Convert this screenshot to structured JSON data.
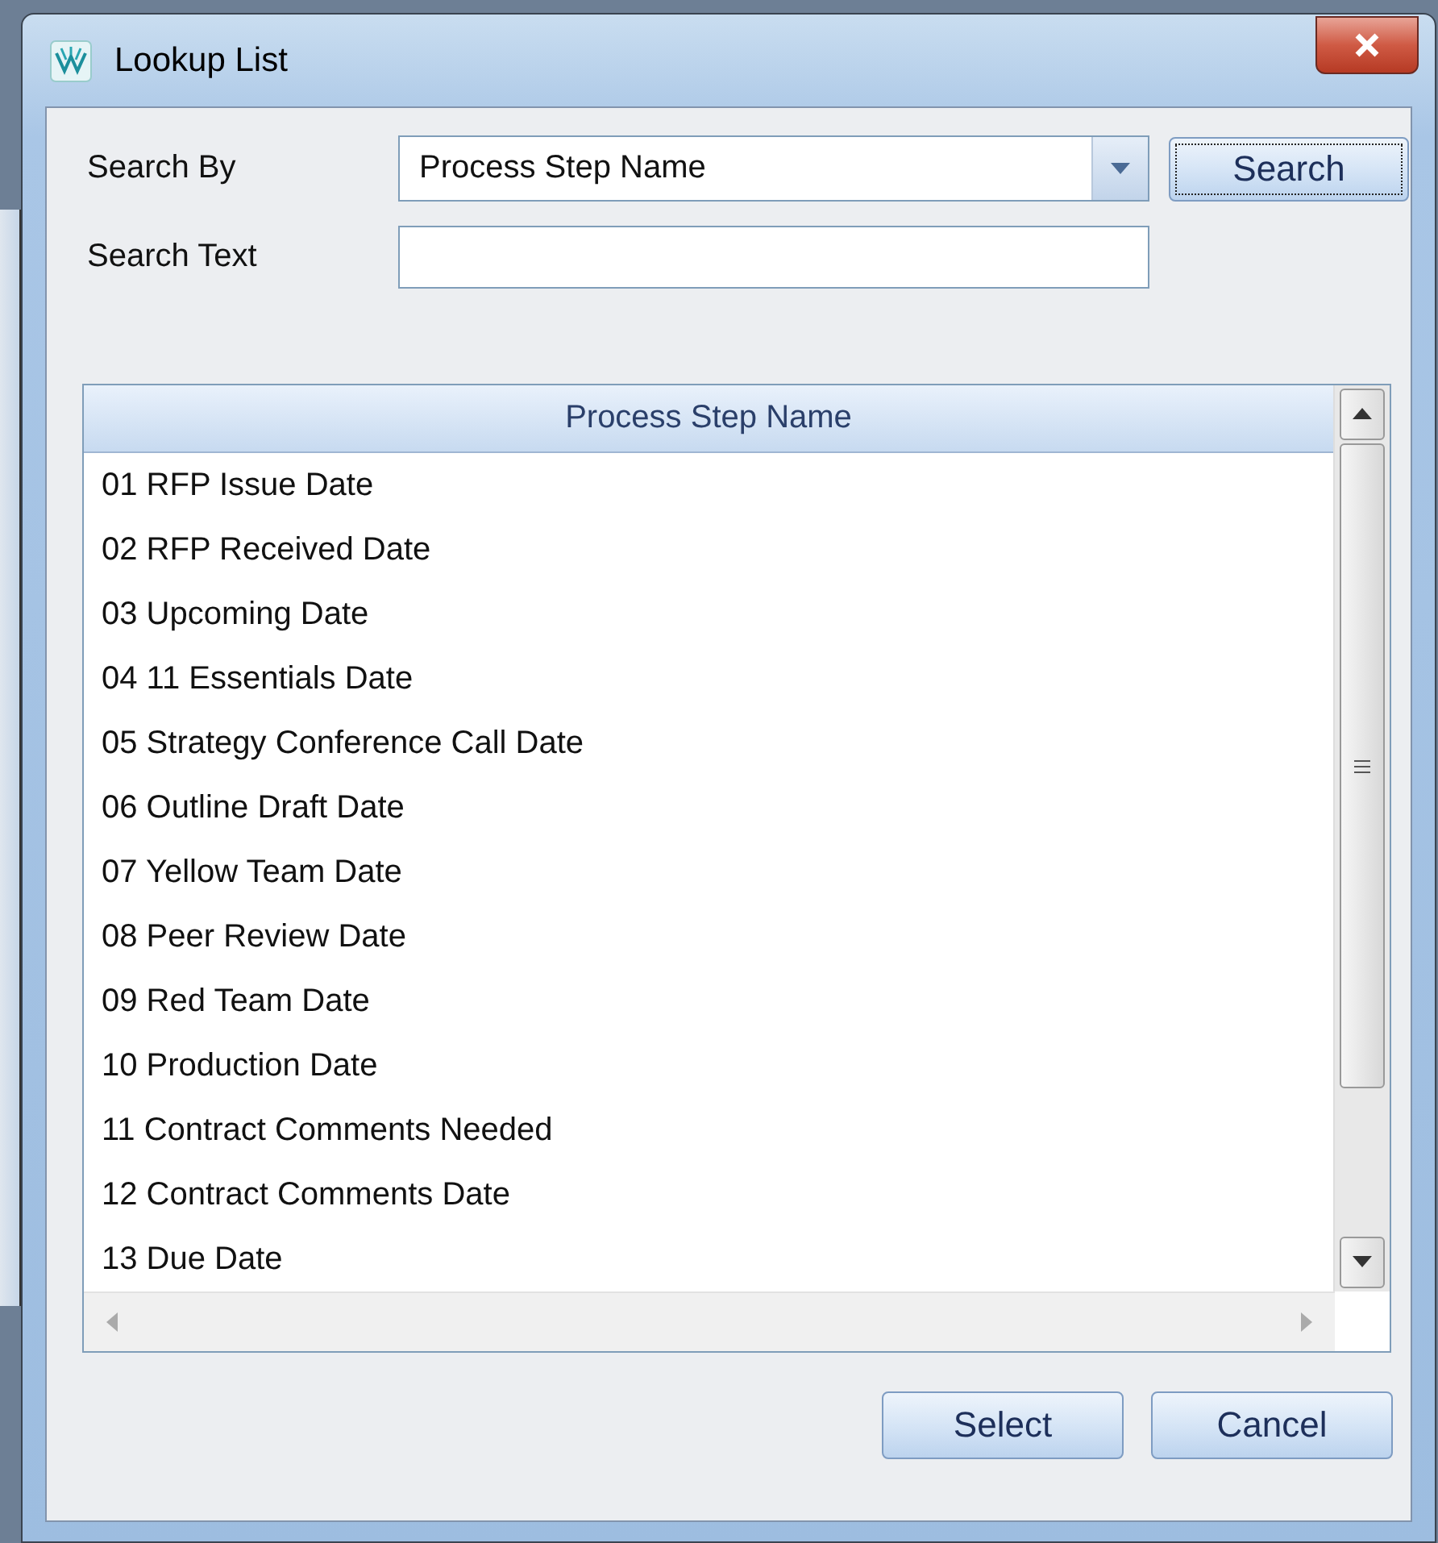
{
  "window": {
    "title": "Lookup List"
  },
  "form": {
    "search_by": {
      "label": "Search By",
      "value": "Process Step Name"
    },
    "search_text": {
      "label": "Search Text"
    },
    "search_button": {
      "label": "Search",
      "focused": true
    }
  },
  "table": {
    "columns": [
      "Process Step Name"
    ],
    "rows": [
      {
        "name": "01 RFP Issue Date"
      },
      {
        "name": "02 RFP Received Date"
      },
      {
        "name": "03 Upcoming Date"
      },
      {
        "name": "04 11 Essentials Date"
      },
      {
        "name": "05 Strategy Conference Call Date"
      },
      {
        "name": "06 Outline Draft Date"
      },
      {
        "name": "07 Yellow Team Date"
      },
      {
        "name": "08 Peer Review Date"
      },
      {
        "name": "09 Red Team Date"
      },
      {
        "name": "10 Production Date"
      },
      {
        "name": "11 Contract Comments Needed"
      },
      {
        "name": "12 Contract Comments Date"
      },
      {
        "name": "13 Due Date"
      }
    ]
  },
  "buttons": [
    "Select",
    "Cancel"
  ]
}
